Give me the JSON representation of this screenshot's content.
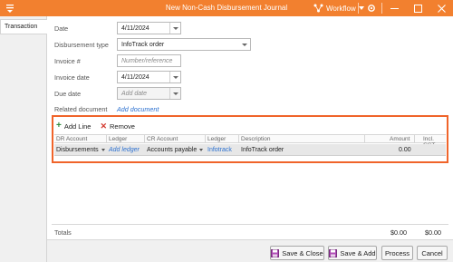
{
  "window": {
    "title": "New Non-Cash Disbursement Journal",
    "workflow_label": "Workflow",
    "accent": "#f2802f"
  },
  "tabs": [
    {
      "label": "Transaction",
      "active": true
    }
  ],
  "form": {
    "date": {
      "label": "Date",
      "value": "4/11/2024"
    },
    "disbursement_type": {
      "label": "Disbursement type",
      "value": "InfoTrack order"
    },
    "invoice_number": {
      "label": "Invoice #",
      "placeholder": "Number/reference"
    },
    "invoice_date": {
      "label": "Invoice date",
      "value": "4/11/2024"
    },
    "due_date": {
      "label": "Due date",
      "placeholder": "Add date"
    },
    "related_document": {
      "label": "Related document",
      "link": "Add document"
    }
  },
  "grid": {
    "toolbar": {
      "add_label": "Add Line",
      "remove_label": "Remove"
    },
    "columns": [
      "DR Account",
      "Ledger",
      "CR Account",
      "Ledger",
      "Description",
      "Amount",
      "Incl. GST"
    ],
    "rows": [
      {
        "dr_account": "Disbursements",
        "dr_ledger": "Add ledger",
        "cr_account": "Accounts payable",
        "cr_ledger": "Infotrack",
        "description": "InfoTrack order",
        "amount": "0.00",
        "incl_gst": ""
      }
    ],
    "highlight_color": "#f0642a"
  },
  "totals": {
    "label": "Totals",
    "amount": "$0.00",
    "gst": "$0.00"
  },
  "buttons": {
    "save_close": "Save & Close",
    "save_add": "Save & Add",
    "process": "Process",
    "cancel": "Cancel"
  },
  "icons": [
    "app-menu-icon",
    "workflow-icon",
    "settings-icon",
    "minimize-icon",
    "maximize-icon",
    "close-icon",
    "add-icon",
    "remove-icon",
    "save-icon"
  ]
}
